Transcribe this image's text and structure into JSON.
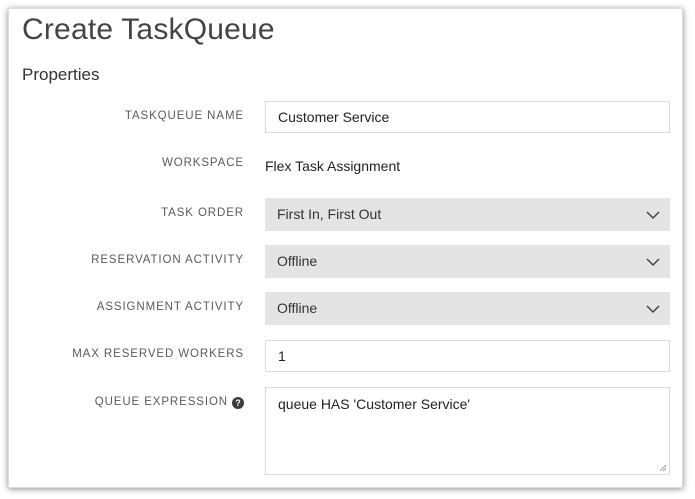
{
  "page": {
    "title": "Create TaskQueue",
    "section": "Properties"
  },
  "form": {
    "taskqueue_name": {
      "label": "TASKQUEUE NAME",
      "value": "Customer Service"
    },
    "workspace": {
      "label": "WORKSPACE",
      "value": "Flex Task Assignment"
    },
    "task_order": {
      "label": "TASK ORDER",
      "value": "First In, First Out"
    },
    "reservation_activity": {
      "label": "RESERVATION ACTIVITY",
      "value": "Offline"
    },
    "assignment_activity": {
      "label": "ASSIGNMENT ACTIVITY",
      "value": "Offline"
    },
    "max_reserved_workers": {
      "label": "MAX RESERVED WORKERS",
      "value": "1"
    },
    "queue_expression": {
      "label": "QUEUE EXPRESSION",
      "value": "queue HAS 'Customer Service'",
      "help_icon": "question-circle-icon",
      "help_glyph": "?"
    }
  },
  "colors": {
    "select_background": "#e4e4e4",
    "input_border": "#dadada",
    "label_text": "#5a5a5a"
  }
}
